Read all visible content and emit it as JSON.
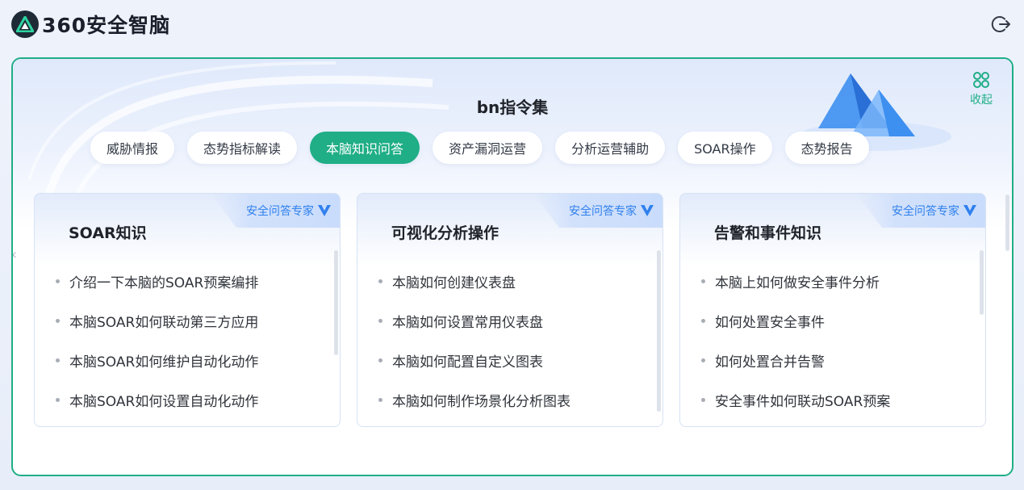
{
  "app": {
    "brand_text": "360安全智脑",
    "logo_icon": "a-logo-icon",
    "logout_icon": "logout-icon"
  },
  "panel": {
    "title": "bn指令集",
    "collapse_label": "收起",
    "collapse_icon": "collapse-icon",
    "tabs": [
      {
        "label": "威胁情报"
      },
      {
        "label": "态势指标解读"
      },
      {
        "label": "本脑知识问答",
        "active": true
      },
      {
        "label": "资产漏洞运营"
      },
      {
        "label": "分析运营辅助"
      },
      {
        "label": "SOAR操作"
      },
      {
        "label": "态势报告"
      }
    ],
    "cards": [
      {
        "badge": "安全问答专家",
        "title": "SOAR知识",
        "items": [
          "介绍一下本脑的SOAR预案编排",
          "本脑SOAR如何联动第三方应用",
          "本脑SOAR如何维护自动化动作",
          "本脑SOAR如何设置自动化动作"
        ]
      },
      {
        "badge": "安全问答专家",
        "title": "可视化分析操作",
        "items": [
          "本脑如何创建仪表盘",
          "本脑如何设置常用仪表盘",
          "本脑如何配置自定义图表",
          "本脑如何制作场景化分析图表"
        ]
      },
      {
        "badge": "安全问答专家",
        "title": "告警和事件知识",
        "items": [
          "本脑上如何做安全事件分析",
          "如何处置安全事件",
          "如何处置合并告警",
          "安全事件如何联动SOAR预案"
        ]
      }
    ]
  },
  "colors": {
    "accent": "#1fae86",
    "badge_blue": "#2f80ed"
  }
}
